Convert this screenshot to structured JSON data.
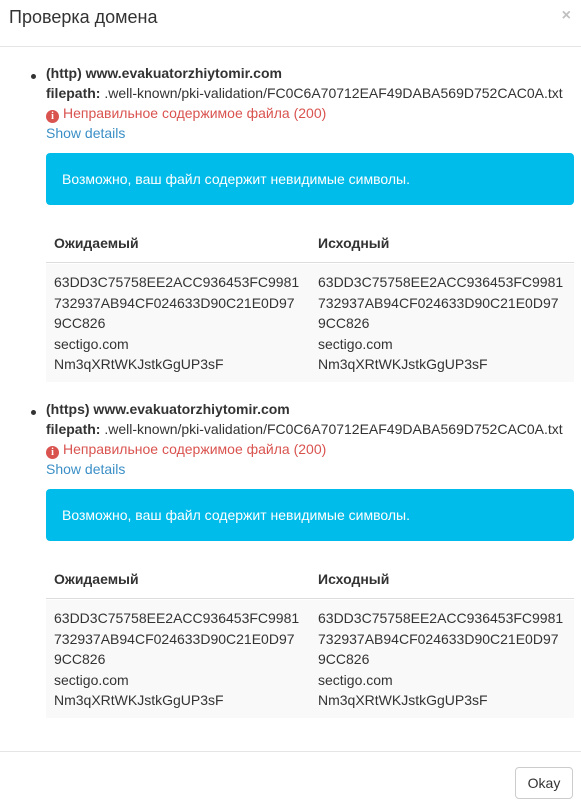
{
  "dialog": {
    "title": "Проверка домена",
    "close_label": "×",
    "ok_label": "Okay"
  },
  "entries": [
    {
      "domain": "(http) www.evakuatorzhiytomir.com",
      "filepath_label": "filepath:",
      "filepath": " .well-known/pki-validation/FC0C6A70712EAF49DABA569D752CAC0A.txt",
      "error_icon": "info-circle-icon",
      "error": "Неправильное содержимое файла (200)",
      "details_link": "Show details",
      "alert": "Возможно, ваш файл содержит невидимые символы.",
      "table": {
        "headers": [
          "Ожидаемый",
          "Исходный"
        ],
        "expected": [
          "63DD3C75758EE2ACC936453FC9981",
          "732937AB94CF024633D90C21E0D97",
          "9CC826",
          "sectigo.com",
          "Nm3qXRtWKJstkGgUP3sF"
        ],
        "actual": [
          "63DD3C75758EE2ACC936453FC9981",
          "732937AB94CF024633D90C21E0D97",
          "9CC826",
          "sectigo.com",
          "Nm3qXRtWKJstkGgUP3sF"
        ]
      }
    },
    {
      "domain": "(https) www.evakuatorzhiytomir.com",
      "filepath_label": "filepath:",
      "filepath": " .well-known/pki-validation/FC0C6A70712EAF49DABA569D752CAC0A.txt",
      "error_icon": "info-circle-icon",
      "error": "Неправильное содержимое файла (200)",
      "details_link": "Show details",
      "alert": "Возможно, ваш файл содержит невидимые символы.",
      "table": {
        "headers": [
          "Ожидаемый",
          "Исходный"
        ],
        "expected": [
          "63DD3C75758EE2ACC936453FC9981",
          "732937AB94CF024633D90C21E0D97",
          "9CC826",
          "sectigo.com",
          "Nm3qXRtWKJstkGgUP3sF"
        ],
        "actual": [
          "63DD3C75758EE2ACC936453FC9981",
          "732937AB94CF024633D90C21E0D97",
          "9CC826",
          "sectigo.com",
          "Nm3qXRtWKJstkGgUP3sF"
        ]
      }
    }
  ],
  "colors": {
    "alert_bg": "#00bcea",
    "error": "#d9534f",
    "link": "#3b8fc6"
  }
}
